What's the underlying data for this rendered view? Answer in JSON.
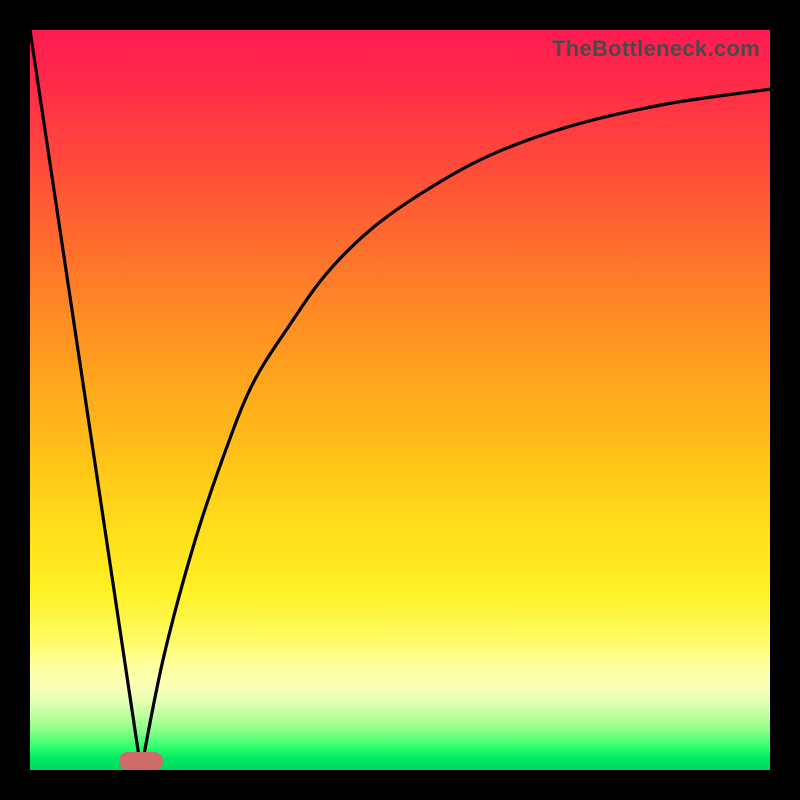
{
  "watermark": "TheBottleneck.com",
  "chart_data": {
    "type": "line",
    "title": "",
    "xlabel": "",
    "ylabel": "",
    "xlim": [
      0,
      100
    ],
    "ylim": [
      0,
      100
    ],
    "grid": false,
    "legend": false,
    "series": [
      {
        "name": "left-line",
        "x": [
          0,
          15
        ],
        "y": [
          100,
          0
        ]
      },
      {
        "name": "right-curve",
        "x": [
          15,
          18,
          22,
          26,
          30,
          35,
          40,
          46,
          53,
          62,
          73,
          86,
          100
        ],
        "y": [
          0,
          15,
          30,
          42,
          52,
          60,
          67,
          73,
          78,
          83,
          87,
          90,
          92
        ]
      }
    ],
    "marker": {
      "name": "bottleneck-marker",
      "x_center": 15,
      "width_pct": 6,
      "color": "#cf6b68"
    },
    "background_gradient": {
      "top": "#ff1a52",
      "mid": "#ffdf1a",
      "bottom": "#00d85c"
    }
  }
}
